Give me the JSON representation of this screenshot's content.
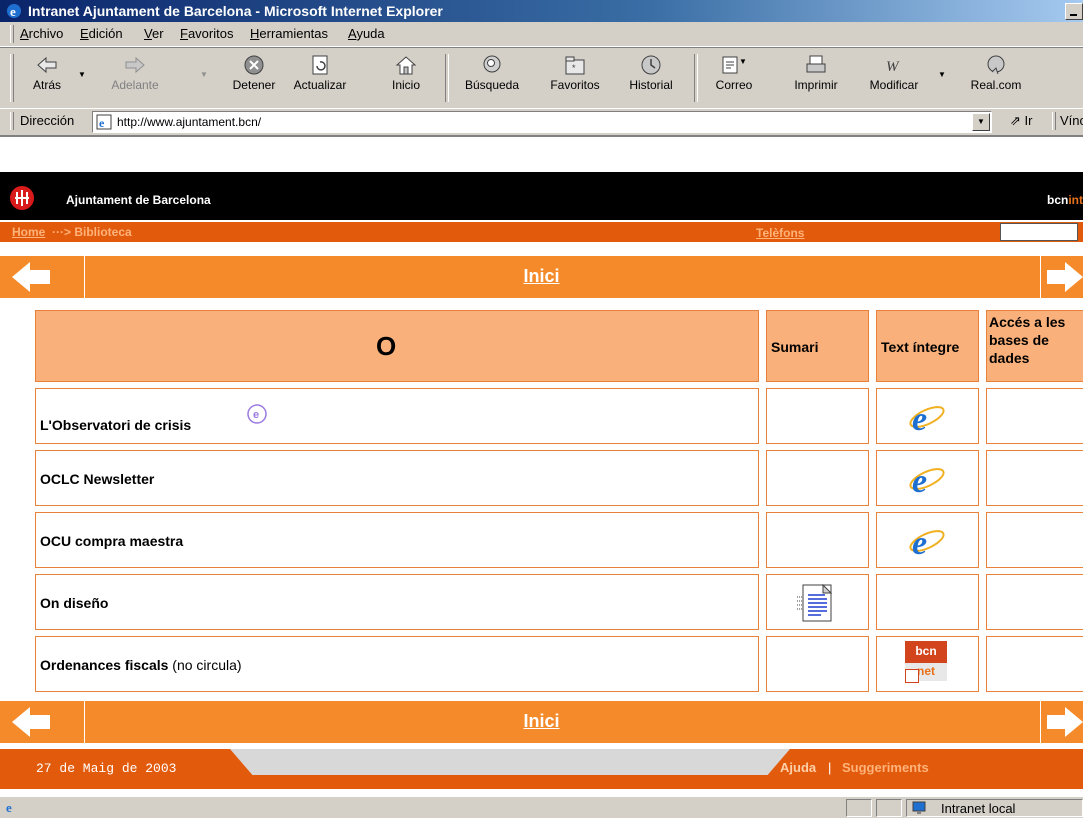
{
  "window": {
    "title": "Intranet Ajuntament de Barcelona - Microsoft Internet Explorer"
  },
  "menu": [
    "Archivo",
    "Edición",
    "Ver",
    "Favoritos",
    "Herramientas",
    "Ayuda"
  ],
  "toolbar": {
    "back": "Atrás",
    "forward": "Adelante",
    "stop": "Detener",
    "refresh": "Actualizar",
    "home": "Inicio",
    "search": "Búsqueda",
    "favorites": "Favoritos",
    "history": "Historial",
    "mail": "Correo",
    "print": "Imprimir",
    "edit": "Modificar",
    "realcom": "Real.com"
  },
  "address": {
    "label": "Dirección",
    "url": "http://www.ajuntament.bcn/",
    "go": "Ir",
    "links": "Vínc"
  },
  "site": {
    "title": "Ajuntament de Barcelona",
    "brand_a": "bcn",
    "brand_b": "int",
    "breadcrumb_home": "Home",
    "breadcrumb_rest": "···> Biblioteca",
    "telefons": "Telèfons",
    "inici": "Inici"
  },
  "table": {
    "letter": "O",
    "col_sumari": "Sumari",
    "col_text": "Text íntegre",
    "col_acces": "Accés a les bases de dades",
    "rows": [
      {
        "name": "L'Observatori de crisis",
        "note": "",
        "e_badge": "e",
        "sumari": "",
        "text": "ie-icon"
      },
      {
        "name": "OCLC Newsletter",
        "note": "",
        "sumari": "",
        "text": "ie-icon"
      },
      {
        "name": "OCU compra maestra",
        "note": "",
        "sumari": "",
        "text": "ie-icon"
      },
      {
        "name": "On diseño",
        "note": "",
        "sumari": "document-icon",
        "text": ""
      },
      {
        "name": "Ordenances fiscals",
        "note": "(no circula)",
        "sumari": "",
        "text": "bcnnet-icon",
        "bcn_top": "bcn",
        "bcn_bottom": "net"
      }
    ]
  },
  "footer": {
    "date": "27 de Maig de 2003",
    "ajuda": "Ajuda",
    "sep": "|",
    "suggeriments": "Suggeriments"
  },
  "status": {
    "zone": "Intranet local"
  },
  "colors": {
    "orange": "#f58a2a",
    "dark_orange": "#e25a0c",
    "peach": "#fab07a",
    "titlebar": "#0a246a"
  }
}
